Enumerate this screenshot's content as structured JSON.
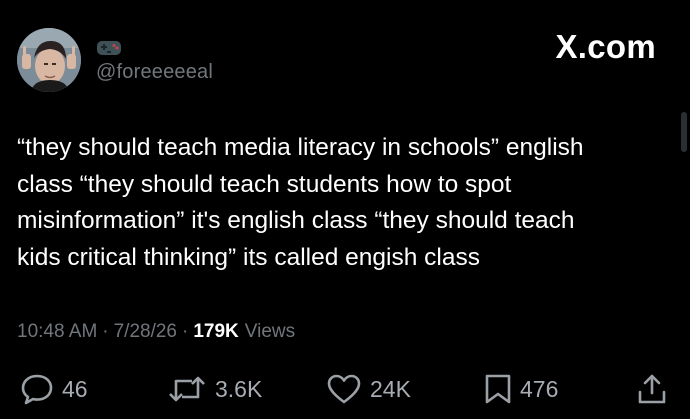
{
  "author": {
    "handle": "@foreeeeeal",
    "badge_icon": "gamepad-icon",
    "avatar_icon": "avatar-photo"
  },
  "brand": {
    "label": "X.com"
  },
  "tweet": {
    "text": "“they should teach media literacy in schools” english\nclass “they should teach students how to spot\nmisinformation”  it's english class “they should teach\nkids critical thinking” its called engish class"
  },
  "meta": {
    "time": "10:48 AM",
    "date": "7/28/26",
    "sep": "·",
    "views_count": "179K",
    "views_label": "Views"
  },
  "actions": {
    "replies": "46",
    "reposts": "3.6K",
    "likes": "24K",
    "bookmarks": "476"
  },
  "colors": {
    "background": "#000000",
    "text": "#ffffff",
    "secondary": "#71767b"
  }
}
